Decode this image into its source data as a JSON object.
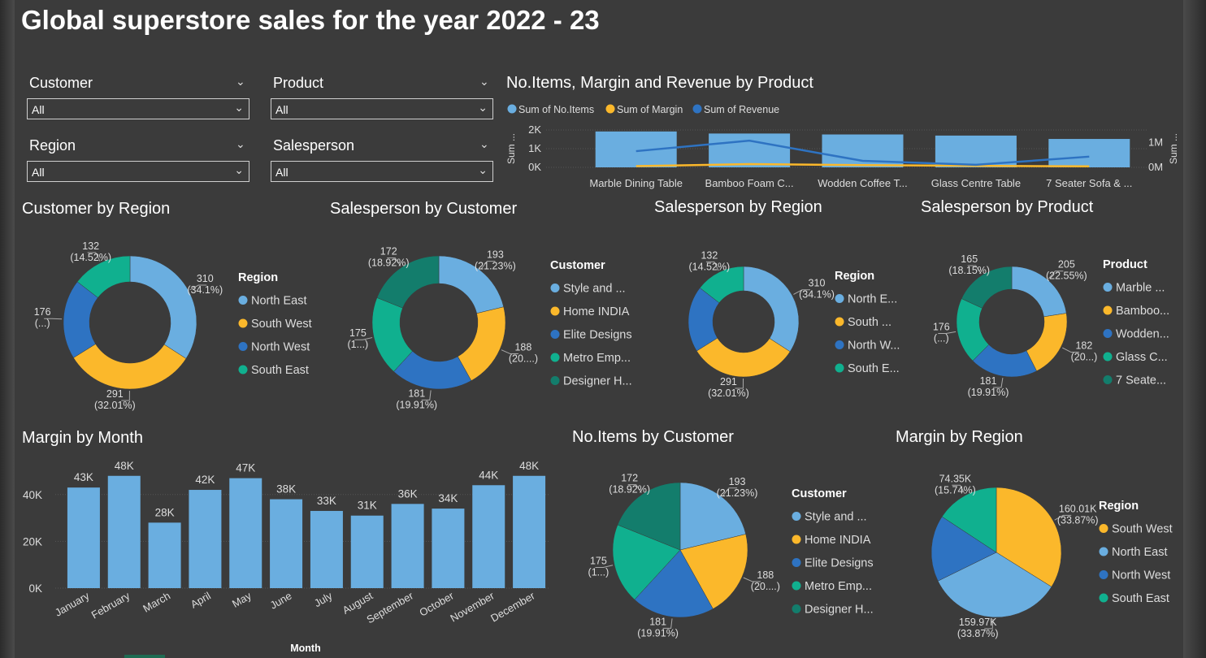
{
  "title": "Global superstore sales for the year 2022 - 23",
  "colors": {
    "c1": "#6aaee0",
    "c2": "#fbb82b",
    "c3": "#2e73c2",
    "c4": "#10b08f",
    "c5": "#137d6c",
    "bg": "#3b3b3b"
  },
  "slicers": [
    {
      "label": "Customer",
      "value": "All"
    },
    {
      "label": "Product",
      "value": "All"
    },
    {
      "label": "Region",
      "value": "All"
    },
    {
      "label": "Salesperson",
      "value": "All"
    }
  ],
  "chart_data": [
    {
      "type": "bar",
      "title": "No.Items, Margin and Revenue by Product",
      "categories": [
        "Marble Dining Table",
        "Bamboo Foam C...",
        "Wodden Coffee T...",
        "Glass Centre Table",
        "7 Seater Sofa & ..."
      ],
      "series": [
        {
          "name": "Sum of No.Items",
          "values": [
            1920,
            1810,
            1760,
            1700,
            1520
          ],
          "render": "bar"
        },
        {
          "name": "Sum of Margin",
          "values": [
            48000,
            130000,
            90000,
            60000,
            40000
          ],
          "render": "line"
        },
        {
          "name": "Sum of Revenue",
          "values": [
            650000,
            1070000,
            260000,
            100000,
            430000
          ],
          "render": "line"
        }
      ],
      "ylabel": "Sum ...",
      "y2label": "Sum ...",
      "ylim": [
        0,
        2000
      ],
      "y2lim": [
        0,
        1500000
      ],
      "yticks": [
        "0K",
        "1K",
        "2K"
      ],
      "y2ticks": [
        "0M",
        "1M"
      ]
    },
    {
      "type": "pie",
      "donut": true,
      "title": "Customer by Region",
      "legend_title": "Region",
      "labels": [
        "North East",
        "South West",
        "North West",
        "South East"
      ],
      "values": [
        310,
        291,
        176,
        132
      ],
      "data_labels": [
        [
          "310",
          "(34.1%)"
        ],
        [
          "291",
          "(32.01%)"
        ],
        [
          "176",
          "(...)"
        ],
        [
          "132",
          "(14.52%)"
        ]
      ]
    },
    {
      "type": "pie",
      "donut": true,
      "title": "Salesperson by Customer",
      "legend_title": "Customer",
      "labels": [
        "Style and ...",
        "Home INDIA",
        "Elite Designs",
        "Metro Emp...",
        "Designer H..."
      ],
      "values": [
        193,
        188,
        181,
        175,
        172
      ],
      "data_labels": [
        [
          "193",
          "(21.23%)"
        ],
        [
          "188",
          "(20....)"
        ],
        [
          "181",
          "(19.91%)"
        ],
        [
          "175",
          "(1...)"
        ],
        [
          "172",
          "(18.92%)"
        ]
      ]
    },
    {
      "type": "pie",
      "donut": true,
      "title": "Salesperson by Region",
      "legend_title": "Region",
      "labels": [
        "North E...",
        "South ...",
        "North W...",
        "South E..."
      ],
      "values": [
        310,
        291,
        176,
        132
      ],
      "data_labels": [
        [
          "310",
          "(34.1%)"
        ],
        [
          "291",
          "(32.01%)"
        ],
        [
          "",
          ""
        ],
        [
          "132",
          "(14.52%)"
        ]
      ]
    },
    {
      "type": "pie",
      "donut": true,
      "title": "Salesperson by Product",
      "legend_title": "Product",
      "labels": [
        "Marble ...",
        "Bamboo...",
        "Wodden...",
        "Glass C...",
        "7 Seate..."
      ],
      "values": [
        205,
        182,
        181,
        176,
        165
      ],
      "data_labels": [
        [
          "205",
          "(22.55%)"
        ],
        [
          "182",
          "(20...)"
        ],
        [
          "181",
          "(19.91%)"
        ],
        [
          "176",
          "(...)"
        ],
        [
          "165",
          "(18.15%)"
        ]
      ]
    },
    {
      "type": "bar",
      "title": "Margin by Month",
      "xlabel": "Month",
      "categories": [
        "January",
        "February",
        "March",
        "April",
        "May",
        "June",
        "July",
        "August",
        "September",
        "October",
        "November",
        "December"
      ],
      "values": [
        43000,
        48000,
        28000,
        42000,
        47000,
        38000,
        33000,
        31000,
        36000,
        34000,
        44000,
        48000
      ],
      "value_labels": [
        "43K",
        "48K",
        "28K",
        "42K",
        "47K",
        "38K",
        "33K",
        "31K",
        "36K",
        "34K",
        "44K",
        "48K"
      ],
      "ylim": [
        0,
        50000
      ],
      "yticks": [
        "0K",
        "20K",
        "40K"
      ]
    },
    {
      "type": "pie",
      "title": "No.Items by Customer",
      "legend_title": "Customer",
      "labels": [
        "Style and ...",
        "Home INDIA",
        "Elite Designs",
        "Metro Emp...",
        "Designer H..."
      ],
      "values": [
        193,
        188,
        181,
        175,
        172
      ],
      "data_labels": [
        [
          "193",
          "(21.23%)"
        ],
        [
          "188",
          "(20....)"
        ],
        [
          "181",
          "(19.91%)"
        ],
        [
          "175",
          "(1...)"
        ],
        [
          "172",
          "(18.92%)"
        ]
      ]
    },
    {
      "type": "pie",
      "title": "Margin by Region",
      "legend_title": "Region",
      "labels": [
        "South West",
        "North East",
        "North West",
        "South East"
      ],
      "values": [
        160010,
        159970,
        78000,
        74350
      ],
      "data_labels": [
        [
          "160.01K",
          "(33.87%)"
        ],
        [
          "159.97K",
          "(33.87%)"
        ],
        [
          "",
          ""
        ],
        [
          "74.35K",
          "(15.74%)"
        ]
      ]
    }
  ]
}
